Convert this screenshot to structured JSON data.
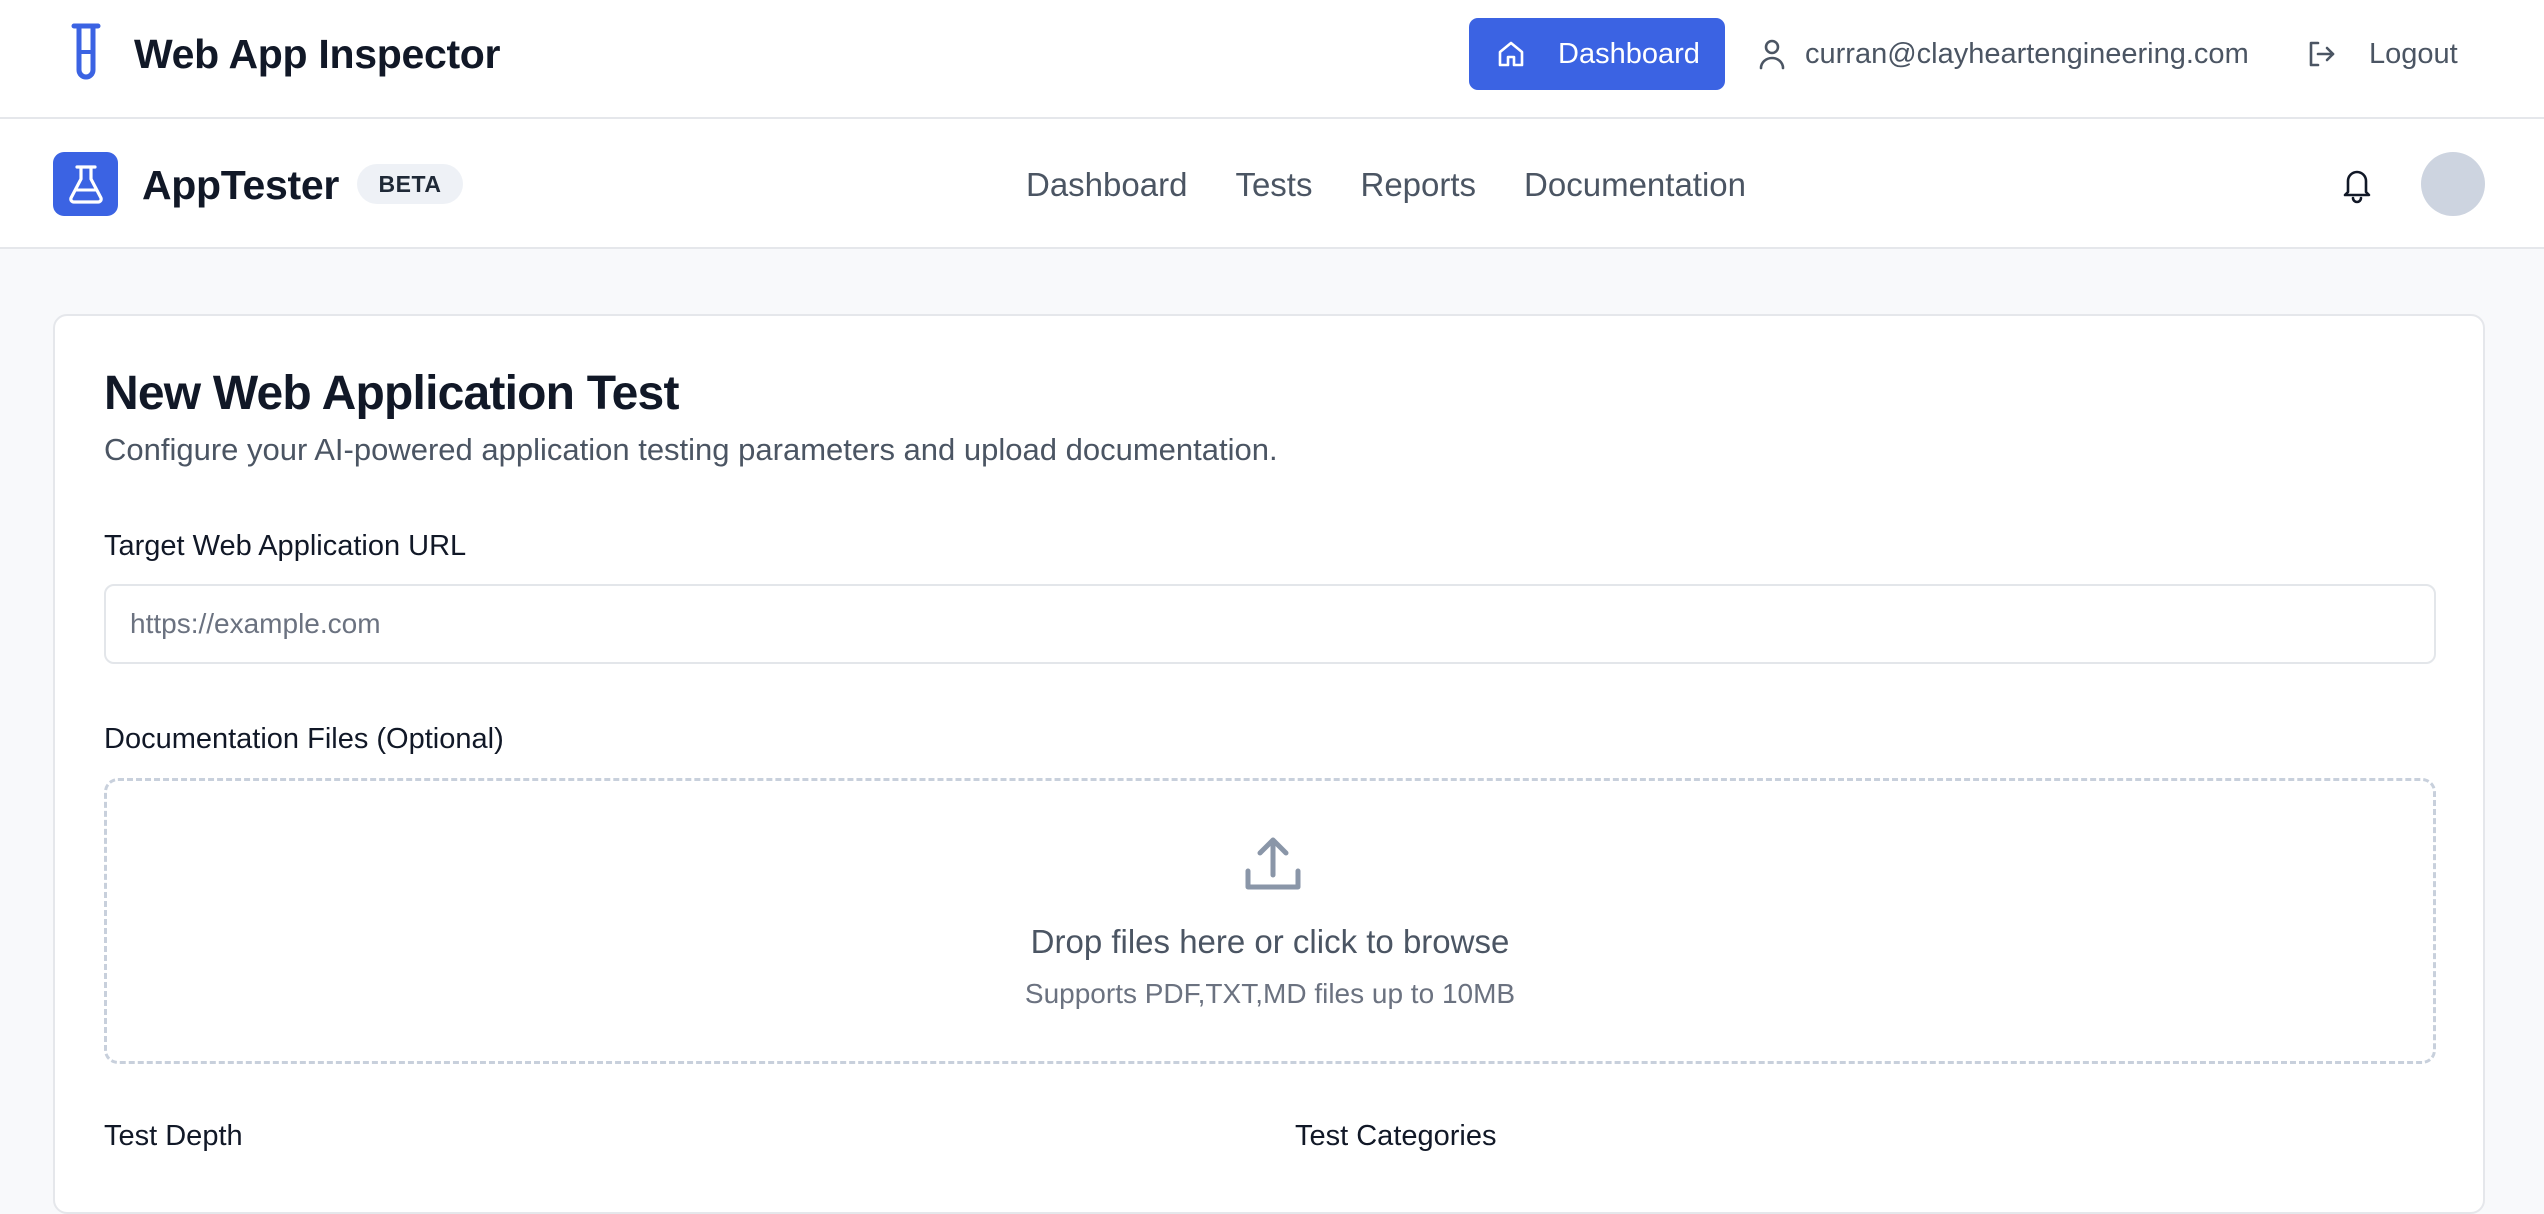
{
  "header": {
    "title": "Web App Inspector",
    "dashboard_button": "Dashboard",
    "user_email": "curran@clayheartengineering.com",
    "logout_label": "Logout"
  },
  "navbar": {
    "app_name": "AppTester",
    "badge": "BETA",
    "links": [
      "Dashboard",
      "Tests",
      "Reports",
      "Documentation"
    ]
  },
  "form": {
    "title": "New Web Application Test",
    "subtitle": "Configure your AI-powered application testing parameters and upload documentation.",
    "url_label": "Target Web Application URL",
    "url_placeholder": "https://example.com",
    "url_value": "",
    "docs_label": "Documentation Files (Optional)",
    "dropzone_title": "Drop files here or click to browse",
    "dropzone_subtitle": "Supports PDF,TXT,MD files up to 10MB",
    "test_depth_label": "Test Depth",
    "test_categories_label": "Test Categories"
  },
  "colors": {
    "accent": "#3b63e3",
    "avatar": "#cdd4e0",
    "muted_text": "#4b5563"
  },
  "icons": {
    "brand": "test-tube-icon",
    "dashboard": "home-icon",
    "user": "user-icon",
    "logout": "logout-icon",
    "app_logo": "flask-icon",
    "notifications": "bell-icon",
    "upload": "upload-icon"
  }
}
